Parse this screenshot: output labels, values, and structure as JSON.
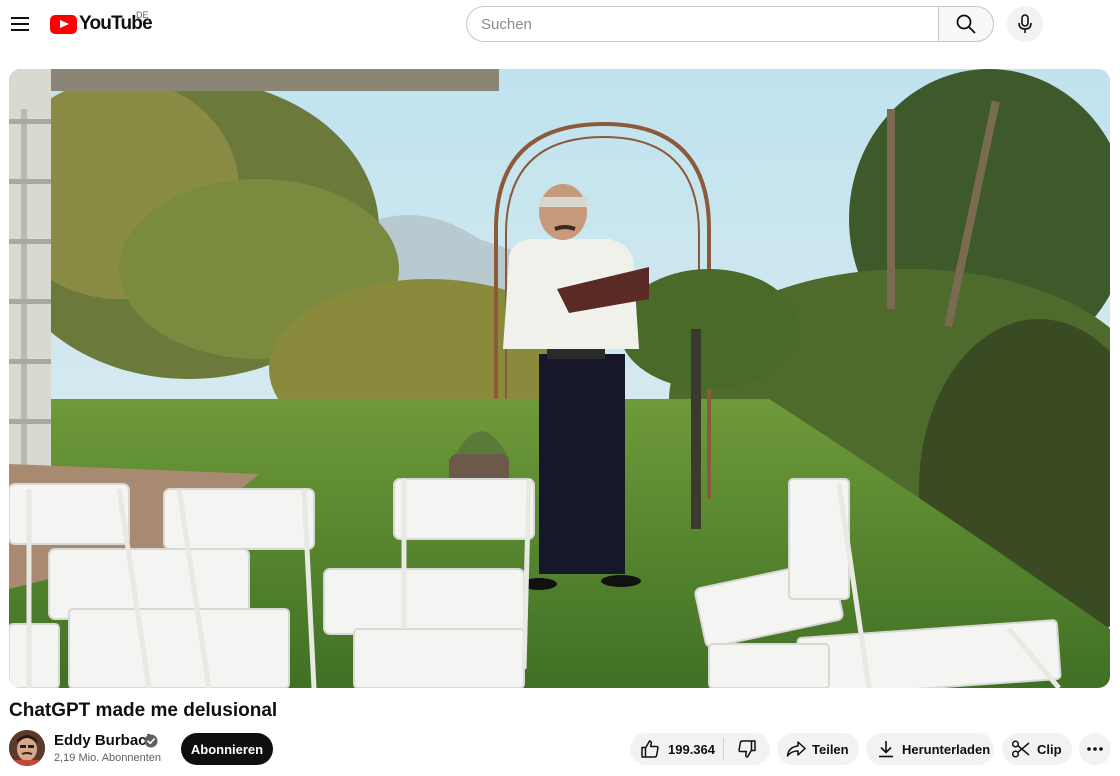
{
  "header": {
    "logo_text": "YouTube",
    "country_code": "DE",
    "search_placeholder": "Suchen",
    "search_value": ""
  },
  "video": {
    "title": "ChatGPT made me delusional"
  },
  "channel": {
    "name": "Eddy Burback",
    "subscribers": "2,19 Mio. Abonnenten",
    "subscribe_label": "Abonnieren"
  },
  "actions": {
    "like_count": "199.364",
    "share_label": "Teilen",
    "download_label": "Herunterladen",
    "clip_label": "Clip"
  },
  "icons": [
    "menu-icon",
    "youtube-logo-icon",
    "search-icon",
    "mic-icon",
    "verified-icon",
    "thumbs-up-icon",
    "thumbs-down-icon",
    "share-icon",
    "download-icon",
    "scissors-icon",
    "more-icon"
  ],
  "colors": {
    "brand_red": "#ff0000",
    "subscribe_bg": "#0f0f0f",
    "pill_bg": "#f2f2f2"
  }
}
